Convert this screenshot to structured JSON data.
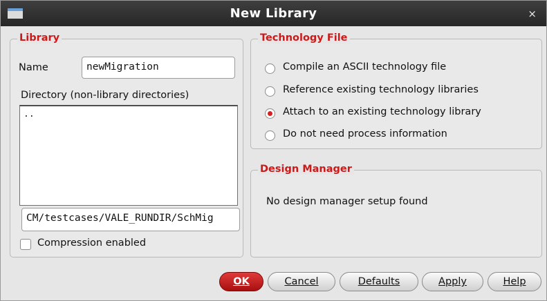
{
  "window": {
    "title": "New Library",
    "close_glyph": "×"
  },
  "library": {
    "title": "Library",
    "name_label": "Name",
    "name_value": "newMigration",
    "directory_label": "Directory (non-library directories)",
    "directory_items": [
      ".."
    ],
    "path_value": "CM/testcases/VALE_RUNDIR/SchMig",
    "compression_label": "Compression enabled",
    "compression_checked": false
  },
  "technology": {
    "title": "Technology File",
    "options": [
      {
        "label": "Compile an ASCII technology file",
        "selected": false
      },
      {
        "label": "Reference existing technology libraries",
        "selected": false
      },
      {
        "label": "Attach to an existing technology library",
        "selected": true
      },
      {
        "label": "Do not need process information",
        "selected": false
      }
    ]
  },
  "design_manager": {
    "title": "Design Manager",
    "message": "No design manager setup found"
  },
  "buttons": {
    "ok": "OK",
    "cancel": "Cancel",
    "defaults": "Defaults",
    "apply": "Apply",
    "help": "Help"
  },
  "colors": {
    "accent_red": "#cc1a1a",
    "titlebar": "#2f2f2f",
    "ok_button": "#c41c1c"
  }
}
